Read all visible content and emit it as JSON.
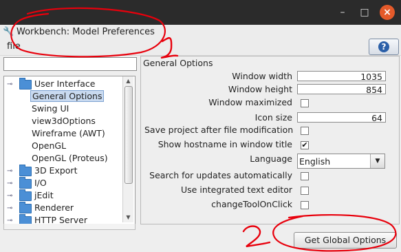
{
  "window": {
    "title": "Workbench: Model Preferences",
    "controls": [
      "minimize-icon",
      "maximize-icon",
      "close-icon"
    ]
  },
  "menu": {
    "items": [
      "file"
    ]
  },
  "help_button": {
    "icon": "help-question-icon",
    "label": "?"
  },
  "search": {
    "value": ""
  },
  "tree": {
    "items": [
      {
        "label": "User Interface",
        "level": 0,
        "expanded": true
      },
      {
        "label": "General Options",
        "level": 1,
        "selected": true
      },
      {
        "label": "Swing UI",
        "level": 1
      },
      {
        "label": "view3dOptions",
        "level": 1
      },
      {
        "label": "Wireframe (AWT)",
        "level": 1
      },
      {
        "label": "OpenGL",
        "level": 1
      },
      {
        "label": "OpenGL (Proteus)",
        "level": 1
      },
      {
        "label": "3D Export",
        "level": 0
      },
      {
        "label": "I/O",
        "level": 0
      },
      {
        "label": "jEdit",
        "level": 0
      },
      {
        "label": "Renderer",
        "level": 0
      },
      {
        "label": "HTTP Server",
        "level": 0
      }
    ]
  },
  "general_options": {
    "title": "General Options",
    "window_width": {
      "label": "Window width",
      "value": "1035"
    },
    "window_height": {
      "label": "Window height",
      "value": "854"
    },
    "window_maximized": {
      "label": "Window maximized",
      "checked": false
    },
    "icon_size": {
      "label": "Icon size",
      "value": "64"
    },
    "save_project": {
      "label": "Save project after file modification",
      "checked": false
    },
    "show_hostname": {
      "label": "Show hostname in window title",
      "checked": true,
      "mark": "✔"
    },
    "language": {
      "label": "Language",
      "value": "English"
    },
    "search_updates": {
      "label": "Search for updates automatically",
      "checked": false
    },
    "integrated_editor": {
      "label": "Use integrated text editor",
      "checked": false
    },
    "change_tool": {
      "label": "changeToolOnClick",
      "checked": false
    }
  },
  "global_button": {
    "label": "Get Global Options"
  },
  "annotations": {
    "color": "#e8000c",
    "labels": [
      "1",
      "2"
    ]
  }
}
